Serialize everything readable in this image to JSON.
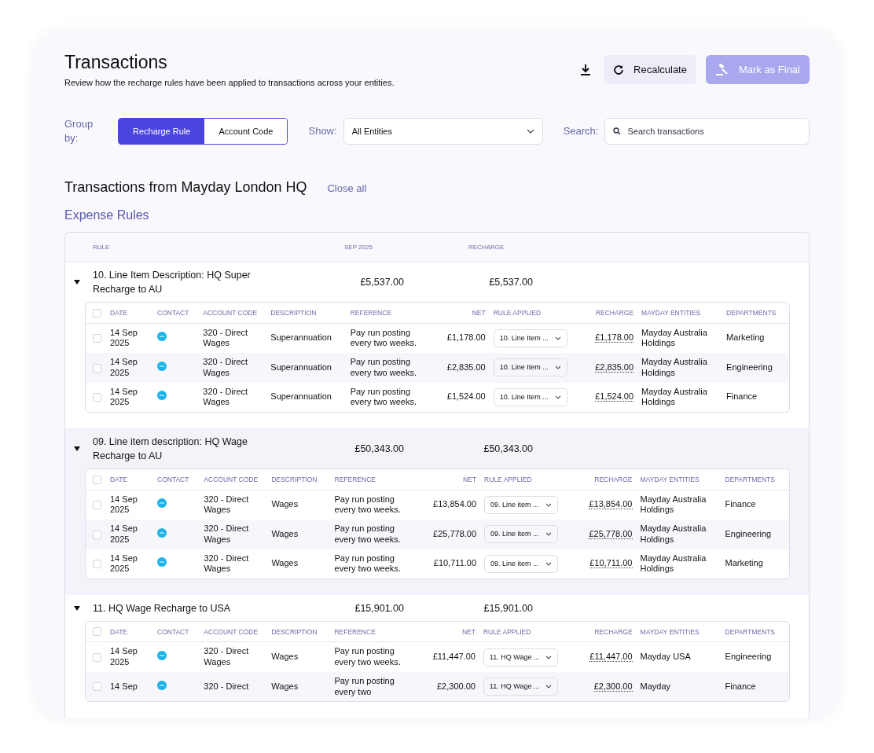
{
  "header": {
    "title": "Transactions",
    "subtitle": "Review how the recharge rules have been applied to transactions across your entities."
  },
  "actions": [
    {
      "kind": "download"
    },
    {
      "kind": "recalculate",
      "label": "Recalculate",
      "disabled": false
    },
    {
      "kind": "final",
      "label": "Mark as Final",
      "disabled": true
    }
  ],
  "group_by": {
    "label": "Group by:",
    "options": [
      {
        "label": "Recharge Rule",
        "selected": true
      },
      {
        "label": "Account Code",
        "selected": false
      }
    ]
  },
  "show": {
    "label": "Show:",
    "value": "All Entities"
  },
  "search": {
    "label": "Search:",
    "placeholder": "Search transactions"
  },
  "section": {
    "title": "Transactions from Mayday London HQ",
    "close_all": "Close all"
  },
  "subsection": "Expense Rules",
  "table": {
    "columns": [
      "RULE",
      "SEP 2025",
      "RECHARGE"
    ],
    "groups": [
      {
        "rule": "10. Line Item Description: HQ Super Recharge to AU",
        "sep": "£5,537.00",
        "recharge": "£5,537.00",
        "expanded": true,
        "highlighted": false,
        "all_checked": false,
        "columns": [
          "DATE",
          "CONTACT",
          "ACCOUNT CODE",
          "DESCRIPTION",
          "REFERENCE",
          "NET",
          "RULE APPLIED",
          "RECHARGE",
          "MAYDAY ENTITIES",
          "DEPARTMENTS"
        ],
        "rows": [
          {
            "checked": false,
            "date": "14 Sep 2025",
            "account_code": "320 - Direct Wages",
            "description": "Superannuation",
            "reference": "Pay run posting every two weeks.",
            "net": "£1,178.00",
            "rule_applied": "10. Line Item ...",
            "recharge": "£1,178.00",
            "entities": "Mayday Australia Holdings",
            "department": "Marketing"
          },
          {
            "checked": false,
            "date": "14 Sep 2025",
            "account_code": "320 - Direct Wages",
            "description": "Superannuation",
            "reference": "Pay run posting every two weeks.",
            "net": "£2,835.00",
            "rule_applied": "10. Line Item ...",
            "recharge": "£2,835.00",
            "entities": "Mayday Australia Holdings",
            "department": "Engineering"
          },
          {
            "checked": false,
            "date": "14 Sep 2025",
            "account_code": "320 - Direct Wages",
            "description": "Superannuation",
            "reference": "Pay run posting every two weeks.",
            "net": "£1,524.00",
            "rule_applied": "10. Line Item ...",
            "recharge": "£1,524.00",
            "entities": "Mayday Australia Holdings",
            "department": "Finance"
          }
        ]
      },
      {
        "rule": "09. Line item description: HQ Wage Recharge to AU",
        "sep": "£50,343.00",
        "recharge": "£50,343.00",
        "expanded": true,
        "highlighted": true,
        "all_checked": false,
        "columns": [
          "DATE",
          "CONTACT",
          "ACCOUNT CODE",
          "DESCRIPTION",
          "REFERENCE",
          "NET",
          "RULE APPLIED",
          "RECHARGE",
          "MAYDAY ENTITIES",
          "DEPARTMENTS"
        ],
        "rows": [
          {
            "checked": false,
            "date": "14 Sep 2025",
            "account_code": "320 - Direct Wages",
            "description": "Wages",
            "reference": "Pay run posting every two weeks.",
            "net": "£13,854.00",
            "rule_applied": "09. Line item ...",
            "recharge": "£13,854.00",
            "entities": "Mayday Australia Holdings",
            "department": "Finance"
          },
          {
            "checked": false,
            "date": "14 Sep 2025",
            "account_code": "320 - Direct Wages",
            "description": "Wages",
            "reference": "Pay run posting every two weeks.",
            "net": "£25,778.00",
            "rule_applied": "09. Line item ...",
            "recharge": "£25,778.00",
            "entities": "Mayday Australia Holdings",
            "department": "Engineering"
          },
          {
            "checked": false,
            "date": "14 Sep 2025",
            "account_code": "320 - Direct Wages",
            "description": "Wages",
            "reference": "Pay run posting every two weeks.",
            "net": "£10,711.00",
            "rule_applied": "09. Line item ...",
            "recharge": "£10,711.00",
            "entities": "Mayday Australia Holdings",
            "department": "Marketing"
          }
        ]
      },
      {
        "rule": "11. HQ Wage Recharge to USA",
        "sep": "£15,901.00",
        "recharge": "£15,901.00",
        "expanded": true,
        "highlighted": false,
        "all_checked": false,
        "columns": [
          "DATE",
          "CONTACT",
          "ACCOUNT CODE",
          "DESCRIPTION",
          "REFERENCE",
          "NET",
          "RULE APPLIED",
          "RECHARGE",
          "MAYDAY ENTITIES",
          "DEPARTMENTS"
        ],
        "rows": [
          {
            "checked": false,
            "date": "14 Sep 2025",
            "account_code": "320 - Direct Wages",
            "description": "Wages",
            "reference": "Pay run posting every two weeks.",
            "net": "£11,447.00",
            "rule_applied": "11. HQ Wage ...",
            "recharge": "£11,447.00",
            "entities": "Mayday USA",
            "department": "Engineering"
          },
          {
            "checked": false,
            "date": "14 Sep",
            "account_code": "320 - Direct",
            "description": "Wages",
            "reference": "Pay run posting every two",
            "net": "£2,300.00",
            "rule_applied": "11. HQ Wage ...",
            "recharge": "£2,300.00",
            "entities": "Mayday",
            "department": "Finance"
          }
        ]
      }
    ]
  }
}
